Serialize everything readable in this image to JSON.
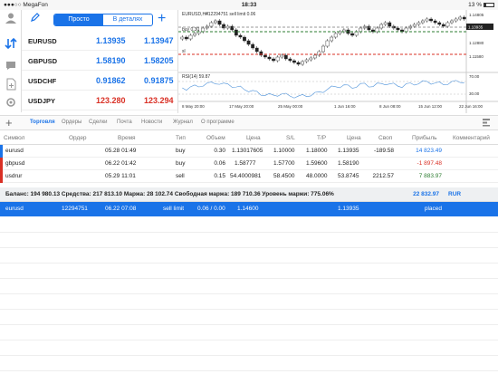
{
  "status": {
    "carrier": "●●●○○ MegaFon",
    "time": "18:33",
    "battery": "13 %"
  },
  "toolbar": {
    "simple_label": "Просто",
    "details_label": "В деталях"
  },
  "quotes": [
    {
      "symbol": "EURUSD",
      "bid": "1.13935",
      "ask": "1.13947",
      "color": "#1a73e8"
    },
    {
      "symbol": "GBPUSD",
      "bid": "1.58190",
      "ask": "1.58205",
      "color": "#1a73e8"
    },
    {
      "symbol": "USDCHF",
      "bid": "0.91862",
      "ask": "0.91875",
      "color": "#1a73e8"
    },
    {
      "symbol": "USDJPY",
      "bid": "123.280",
      "ask": "123.294",
      "color": "#d93025"
    }
  ],
  "chart": {
    "header": "EURUSD,H4",
    "order_label": "#12294751 sell limit 0.06",
    "buy_label": "buy 0.30",
    "sl_label": "sl",
    "rsi_label": "RSI(14) 59.87",
    "price_ticks": [
      "1.14805",
      "1.13935",
      "1.12880",
      "1.11580"
    ],
    "current_price": "1.13935",
    "rsi_ticks": [
      "70.00",
      "30.00"
    ],
    "time_ticks": [
      "8 May 20:00",
      "17 May 20:00",
      "25 May 00:00",
      "1 Jun 16:00",
      "8 Jun 08:00",
      "15 Jun 12:00",
      "22 Jun 16:00"
    ]
  },
  "tabs": [
    "Торговля",
    "Ордеры",
    "Сделки",
    "Почта",
    "Новости",
    "Журнал",
    "О программе"
  ],
  "columns": [
    "Символ",
    "Ордер",
    "Время",
    "Тип",
    "Объем",
    "Цена",
    "S/L",
    "T/P",
    "Цена",
    "Своп",
    "Прибыль",
    "Комментарий"
  ],
  "positions": [
    {
      "symbol": "eurusd",
      "order": "",
      "time": "05.28 01:49",
      "type": "buy",
      "volume": "0.30",
      "price": "1.13017605",
      "sl": "1.10000",
      "tp": "1.18000",
      "cur": "1.13935",
      "swap": "-189.58",
      "profit": "14 823.49",
      "profit_color": "#1a73e8",
      "bar": "#1a73e8"
    },
    {
      "symbol": "gbpusd",
      "order": "",
      "time": "06.22 01:42",
      "type": "buy",
      "volume": "0.06",
      "price": "1.58777",
      "sl": "1.57700",
      "tp": "1.59600",
      "cur": "1.58190",
      "swap": "",
      "profit": "-1 897.48",
      "profit_color": "#d93025",
      "bar": "#d93025"
    },
    {
      "symbol": "usdrur",
      "order": "",
      "time": "05.29 11:01",
      "type": "sell",
      "volume": "0.15",
      "price": "54.4000981",
      "sl": "58.4500",
      "tp": "48.0000",
      "cur": "53.8745",
      "swap": "2212.57",
      "profit": "7 883.97",
      "profit_color": "#2e7d32",
      "bar": "#d93025"
    }
  ],
  "balance": {
    "text": "Баланс: 194 980.13 Средства: 217 813.10 Маржа: 28 102.74 Свободная маржа: 189 710.36 Уровень маржи: 775.06%",
    "value": "22 832.97",
    "currency": "RUR"
  },
  "pending": {
    "symbol": "eurusd",
    "order": "12294751",
    "time": "06.22 07:08",
    "type": "sell limit",
    "volume": "0.06 / 0.00",
    "price": "1.14600",
    "sl": "",
    "tp": "",
    "cur": "1.13935",
    "swap": "",
    "profit": "placed"
  }
}
